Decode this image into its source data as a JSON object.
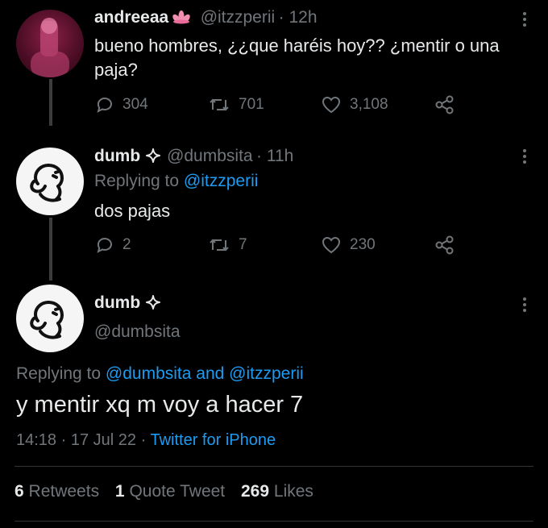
{
  "tweet1": {
    "name": "andreeaa",
    "handle": "@itzzperii",
    "time": "· 12h",
    "text": "bueno hombres, ¿¿que haréis hoy?? ¿mentir o una paja?",
    "reply_count": "304",
    "retweet_count": "701",
    "like_count": "3,108"
  },
  "tweet2": {
    "name": "dumb",
    "handle": "@dumbsita",
    "time": "· 11h",
    "replying_prefix": "Replying to ",
    "replying_to": "@itzzperii",
    "text": "dos pajas",
    "reply_count": "2",
    "retweet_count": "7",
    "like_count": "230"
  },
  "main": {
    "name": "dumb",
    "handle": "@dumbsita",
    "replying_prefix": "Replying to ",
    "replying_user1": "@dumbsita",
    "replying_and": " and ",
    "replying_user2": "@itzzperii",
    "text": "y mentir xq m voy a hacer 7",
    "time": "14:18",
    "date": "17 Jul 22",
    "dot1": "·",
    "dot2": "·",
    "source": "Twitter for iPhone"
  },
  "stats": {
    "retweets_count": "6",
    "retweets_label": "Retweets",
    "quotes_count": "1",
    "quotes_label": "Quote Tweet",
    "likes_count": "269",
    "likes_label": "Likes"
  },
  "colors": {
    "background": "#000000",
    "text": "#e7e9ea",
    "muted": "#71767b",
    "link": "#1d9bf0",
    "badge_flower": "#f28fb0"
  }
}
